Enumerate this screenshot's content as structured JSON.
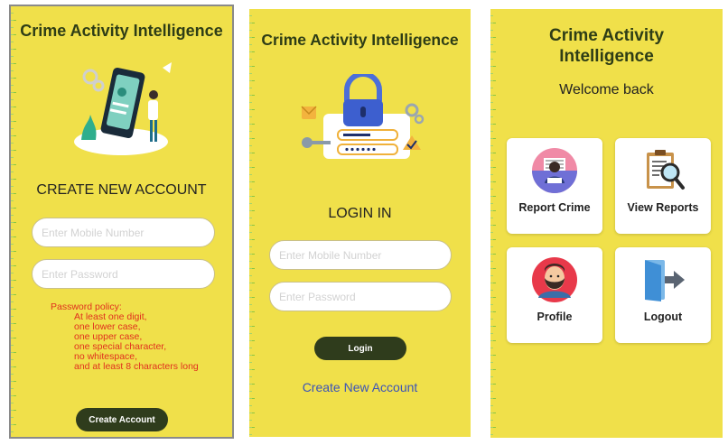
{
  "signup": {
    "title": "Crime Activity Intelligence",
    "heading": "CREATE NEW ACCOUNT",
    "mobile_placeholder": "Enter Mobile Number",
    "password_placeholder": "Enter Password",
    "policy_title": "Password policy:",
    "policy_lines": [
      "At least one digit,",
      "one lower case,",
      "one upper case,",
      "one special character,",
      "no whitespace,",
      "and at least 8 characters long"
    ],
    "button": "Create Account"
  },
  "login": {
    "title": "Crime Activity Intelligence",
    "heading": "LOGIN IN",
    "mobile_placeholder": "Enter Mobile Number",
    "password_placeholder": "Enter Password",
    "button": "Login",
    "create_link": "Create New  Account"
  },
  "home": {
    "title_line1": "Crime Activity",
    "title_line2": "Intelligence",
    "welcome": "Welcome back",
    "cards": [
      {
        "label": "Report Crime",
        "icon": "report-crime-icon"
      },
      {
        "label": "View Reports",
        "icon": "view-reports-icon"
      },
      {
        "label": "Profile",
        "icon": "profile-icon"
      },
      {
        "label": "Logout",
        "icon": "logout-icon"
      }
    ]
  },
  "colors": {
    "background": "#f0e04a",
    "title": "#2e3d16",
    "button": "#2f3c1c",
    "policy": "#e0301e",
    "link": "#3b53b8"
  }
}
